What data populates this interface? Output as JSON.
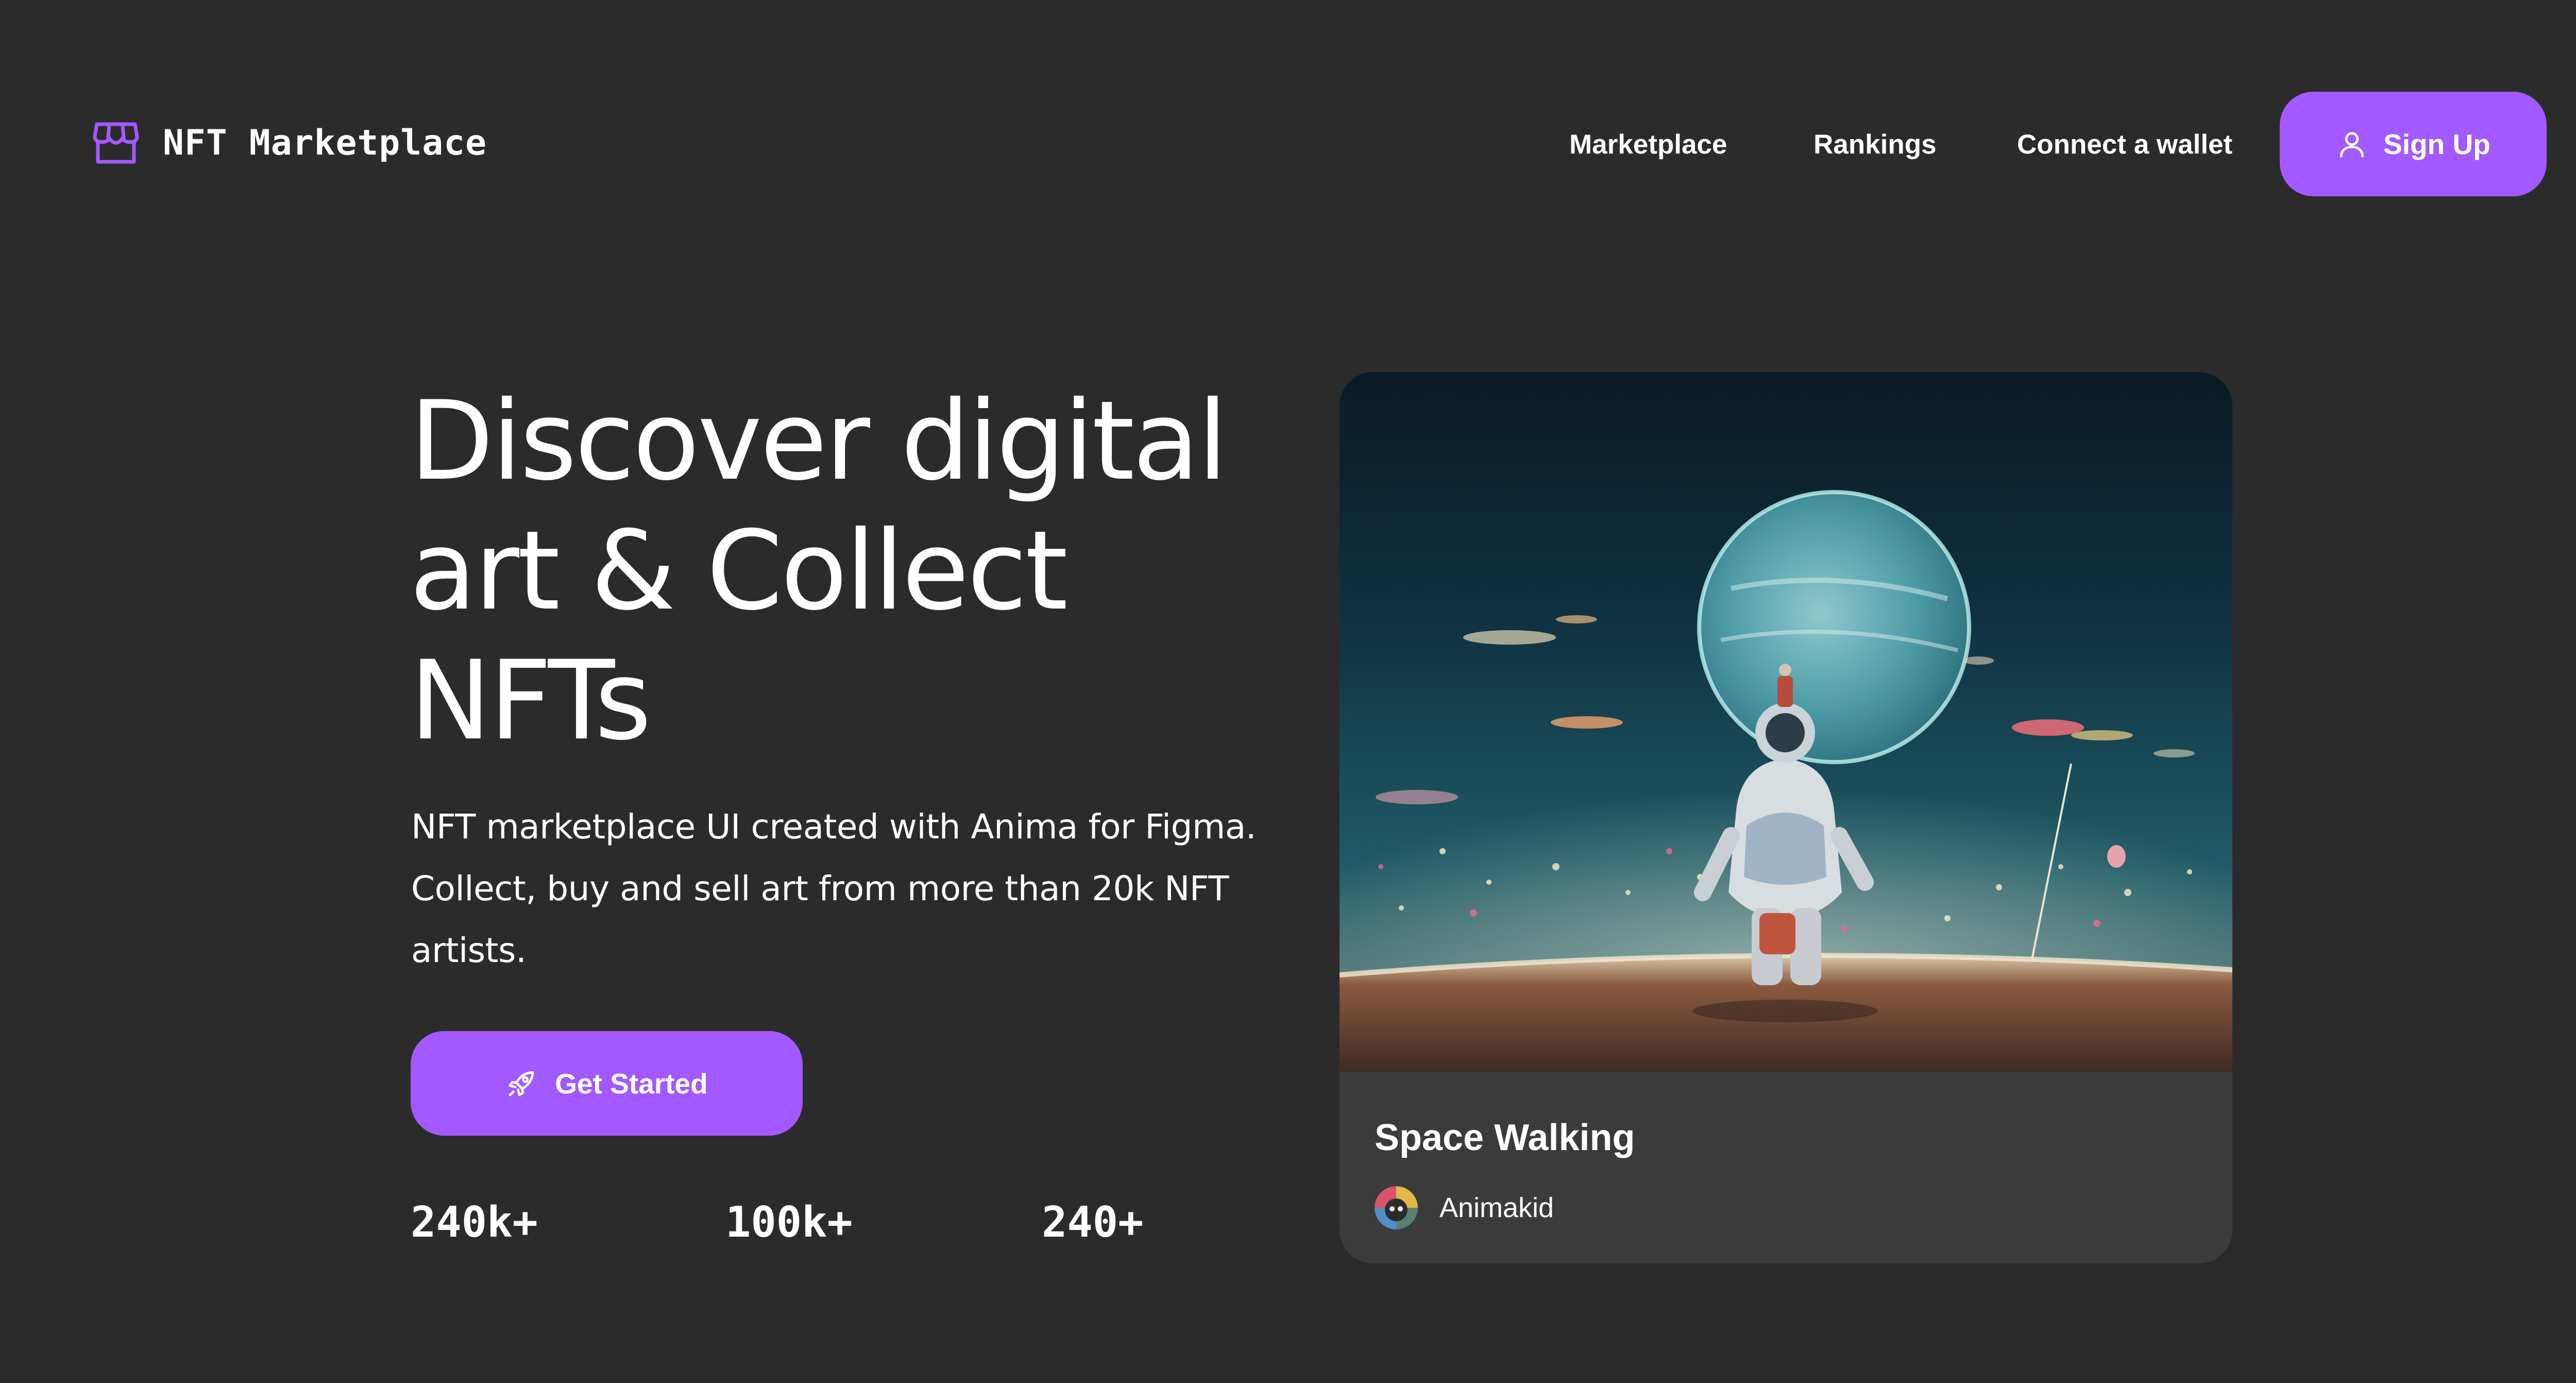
{
  "colors": {
    "background": "#2b2b2b",
    "accent": "#a259ff",
    "card_background": "#3b3b3b",
    "text": "#ffffff"
  },
  "header": {
    "logo_icon": "storefront-icon",
    "logo_text": "NFT Marketplace",
    "nav": [
      {
        "label": "Marketplace"
      },
      {
        "label": "Rankings"
      },
      {
        "label": "Connect a wallet"
      }
    ],
    "signup": {
      "icon": "user-icon",
      "label": "Sign Up"
    }
  },
  "hero": {
    "title": "Discover digital art & Collect NFTs",
    "description": "NFT marketplace UI created with Anima for Figma. Collect, buy and sell art from more than 20k NFT artists.",
    "cta": {
      "icon": "rocket-icon",
      "label": "Get Started"
    },
    "stats": [
      {
        "value": "240k+"
      },
      {
        "value": "100k+"
      },
      {
        "value": "240+"
      }
    ]
  },
  "featured": {
    "image": "astronaut-space-walking-artwork",
    "title": "Space Walking",
    "artist": {
      "avatar": "artist-avatar",
      "name": "Animakid"
    }
  }
}
